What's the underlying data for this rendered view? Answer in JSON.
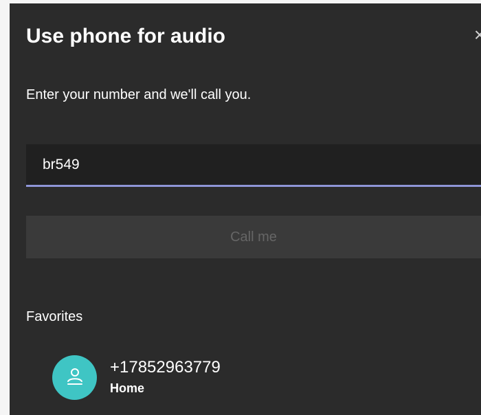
{
  "dialog": {
    "title": "Use phone for audio",
    "close_icon": "close-icon",
    "subtitle": "Enter your number and we'll call you.",
    "phone_input_value": "br549",
    "call_button_label": "Call me",
    "favorites_heading": "Favorites",
    "favorites": [
      {
        "number": "+17852963779",
        "label": "Home",
        "icon": "person-icon"
      }
    ]
  },
  "colors": {
    "dialog_background": "#2b2b2b",
    "input_background": "#202020",
    "input_focus_underline": "#8f96d8",
    "disabled_button_background": "#3a3a3a",
    "disabled_button_text": "#666666",
    "avatar": "#3fc5c4",
    "text": "#ffffff"
  }
}
